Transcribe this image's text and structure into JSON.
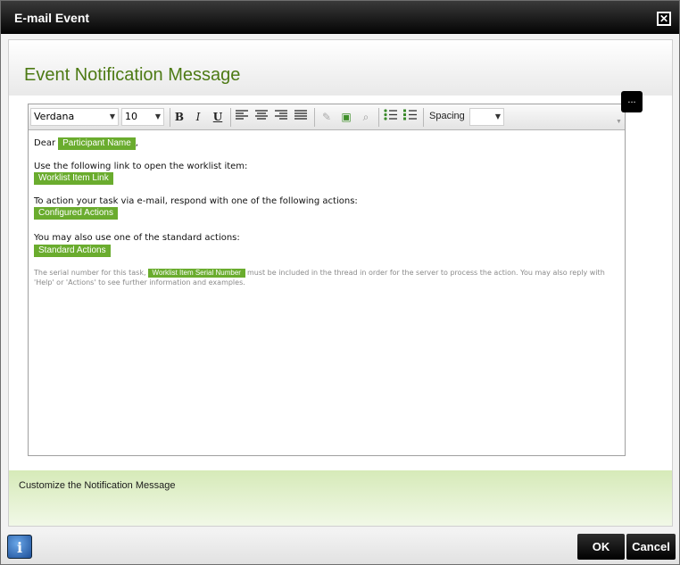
{
  "window": {
    "title": "E-mail Event",
    "close_icon": "close-icon"
  },
  "heading": "Event Notification Message",
  "toolbar": {
    "font_family": "Verdana",
    "font_size": "10",
    "spacing_label": "Spacing",
    "spacing_value": "",
    "buttons": [
      {
        "name": "bold",
        "glyph": "B"
      },
      {
        "name": "italic",
        "glyph": "I"
      },
      {
        "name": "underline",
        "glyph": "U"
      },
      {
        "name": "align-left",
        "glyph": "≡"
      },
      {
        "name": "align-center",
        "glyph": "≡"
      },
      {
        "name": "align-right",
        "glyph": "≡"
      },
      {
        "name": "justify",
        "glyph": "≡"
      },
      {
        "name": "eraser",
        "glyph": "✎"
      },
      {
        "name": "insert-image",
        "glyph": "▣"
      },
      {
        "name": "find",
        "glyph": "⌕"
      },
      {
        "name": "bullet-list",
        "glyph": "☰"
      },
      {
        "name": "numbered-list",
        "glyph": "☰"
      }
    ]
  },
  "body": {
    "greeting": "Dear",
    "token_participant": "Participant Name",
    "comma": ",",
    "link_text": "Use the following link to open the worklist item:",
    "token_worklist_link": "Worklist Item Link",
    "action_text": "To action your task via e-mail, respond with one of the following actions:",
    "token_configured": "Configured Actions",
    "standard_text": "You may also use one of the standard actions:",
    "token_standard": "Standard Actions",
    "serial_pre": "The serial number for this task,",
    "token_serial": "Worklist Item Serial Number",
    "serial_post": "must be included in the thread in order for the server to process the action. You may also reply with 'Help' or 'Actions' to see further information and examples."
  },
  "ellipsis_label": "...",
  "info_text": "Customize the Notification Message",
  "footer": {
    "help_glyph": "i",
    "ok_label": "OK",
    "cancel_label": "Cancel"
  },
  "colors": {
    "accent": "#4d7a14",
    "token": "#6aac2e",
    "info_band": "#d6eab8"
  }
}
